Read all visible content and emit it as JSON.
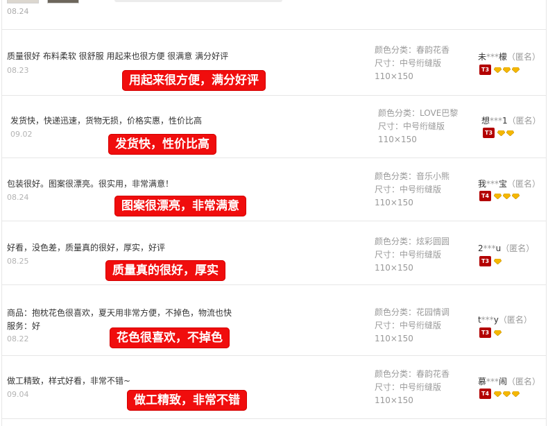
{
  "top": {
    "date": "08.24"
  },
  "reviews": [
    {
      "content": "质量很好 布料柔软 很舒服 用起来也很方便 很满意 满分好评",
      "date": "08.23",
      "highlight": "用起来很方便，满分好评",
      "color_label": "颜色分类：",
      "color": "春韵花香",
      "size_label": "尺寸：",
      "size": "中号绗缝版",
      "dims": "110×150",
      "user": "未",
      "user_mask": "***",
      "user_end": "檬",
      "anon": "（匿名）",
      "level": "T3",
      "gems": 3
    },
    {
      "content": "发货快，快递迅速，货物无损，价格实惠，性价比高",
      "date": "09.02",
      "highlight": "发货快，性价比高",
      "color_label": "颜色分类：",
      "color": "LOVE巴黎",
      "size_label": "尺寸：",
      "size": "中号绗缝版",
      "dims": "110×150",
      "user": "想",
      "user_mask": "***",
      "user_end": "1",
      "anon": "（匿名）",
      "level": "T3",
      "gems": 2
    },
    {
      "content": "包装很好。图案很漂亮。很实用，非常满意！",
      "date": "08.24",
      "highlight": "图案很漂亮，非常满意",
      "color_label": "颜色分类：",
      "color": "音乐小熊",
      "size_label": "尺寸：",
      "size": "中号绗缝版",
      "dims": "110×150",
      "user": "我",
      "user_mask": "***",
      "user_end": "宝",
      "anon": "（匿名）",
      "level": "T4",
      "gems": 3
    },
    {
      "content": "好看，没色差，质量真的很好，厚实，好评",
      "date": "08.25",
      "highlight": "质量真的很好，厚实",
      "color_label": "颜色分类：",
      "color": "炫彩圆圆",
      "size_label": "尺寸：",
      "size": "中号绗缝版",
      "dims": "110×150",
      "user": "2",
      "user_mask": "***",
      "user_end": "u",
      "anon": "（匿名）",
      "level": "T3",
      "gems": 1
    },
    {
      "content": "商品：抱枕花色很喜欢，夏天用非常方便，不掉色，物流也快",
      "content2": "服务：好",
      "date": "08.22",
      "highlight": "花色很喜欢，不掉色",
      "color_label": "颜色分类：",
      "color": "花园情调",
      "size_label": "尺寸：",
      "size": "中号绗缝版",
      "dims": "110×150",
      "user": "t",
      "user_mask": "***",
      "user_end": "y",
      "anon": "（匿名）",
      "level": "T3",
      "gems": 1
    },
    {
      "content": "做工精致，样式好看，非常不错~",
      "date": "09.04",
      "highlight": "做工精致，非常不错",
      "color_label": "颜色分类：",
      "color": "春韵花香",
      "size_label": "尺寸：",
      "size": "中号绗缝版",
      "dims": "110×150",
      "user": "慕",
      "user_mask": "***",
      "user_end": "闹",
      "anon": "（匿名）",
      "level": "T4",
      "gems": 3
    }
  ],
  "colors": {
    "banner": "#f00d0d",
    "level_badge": "#b30000",
    "gem": "#f5b800"
  }
}
